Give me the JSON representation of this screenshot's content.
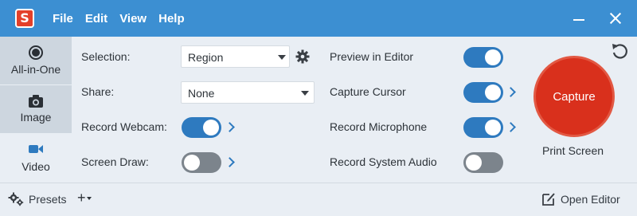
{
  "app": {
    "logo_letter": "S"
  },
  "menu": [
    "File",
    "Edit",
    "View",
    "Help"
  ],
  "window_controls": {
    "minimize_icon": "minimize-icon",
    "close_icon": "close-icon"
  },
  "modes": [
    {
      "label": "All-in-One",
      "icon": "all-in-one-icon",
      "active": false
    },
    {
      "label": "Image",
      "icon": "camera-icon",
      "active": false
    },
    {
      "label": "Video",
      "icon": "video-camera-icon",
      "active": true
    }
  ],
  "settings_left": {
    "selection_label": "Selection:",
    "selection_value": "Region",
    "share_label": "Share:",
    "share_value": "None",
    "webcam_label": "Record Webcam:",
    "webcam_on": true,
    "screen_draw_label": "Screen Draw:",
    "screen_draw_on": false
  },
  "settings_right": {
    "preview_label": "Preview in Editor",
    "preview_on": true,
    "cursor_label": "Capture Cursor",
    "cursor_on": true,
    "microphone_label": "Record Microphone",
    "microphone_on": true,
    "system_audio_label": "Record System Audio",
    "system_audio_on": false
  },
  "capture": {
    "button_label": "Capture",
    "hotkey": "Print Screen"
  },
  "bottom": {
    "presets_label": "Presets",
    "add_label": "+",
    "open_editor_label": "Open Editor"
  },
  "colors": {
    "titlebar": "#3c8fd2",
    "accent": "#2e7abf",
    "capture": "#d9301c",
    "toggle_off": "#7c848c"
  }
}
